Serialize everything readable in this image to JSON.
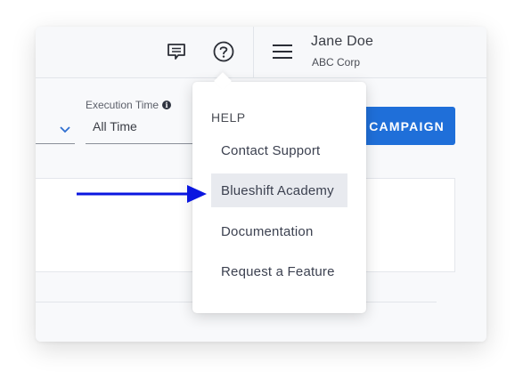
{
  "header": {
    "chat_icon": "chat-bubble-icon",
    "help_icon": "question-circle-icon",
    "menu_icon": "hamburger-menu-icon",
    "user_name": "Jane Doe",
    "user_company": "ABC Corp"
  },
  "filters": {
    "execution_time_label": "Execution Time",
    "execution_time_info_icon": "info-icon",
    "execution_time_value": "All Time",
    "left_select_icon": "chevron-down-icon"
  },
  "toolbar": {
    "campaign_button_label": "CAMPAIGN"
  },
  "help_menu": {
    "heading": "HELP",
    "items": [
      {
        "label": "Contact Support",
        "highlighted": false
      },
      {
        "label": "Blueshift Academy",
        "highlighted": true
      },
      {
        "label": "Documentation",
        "highlighted": false
      },
      {
        "label": "Request a Feature",
        "highlighted": false
      }
    ]
  },
  "annotation": {
    "arrow_color": "#0a16e0",
    "arrow_target": "Blueshift Academy"
  },
  "colors": {
    "accent": "#1f6fd9",
    "highlight_bg": "#e8eaef"
  }
}
